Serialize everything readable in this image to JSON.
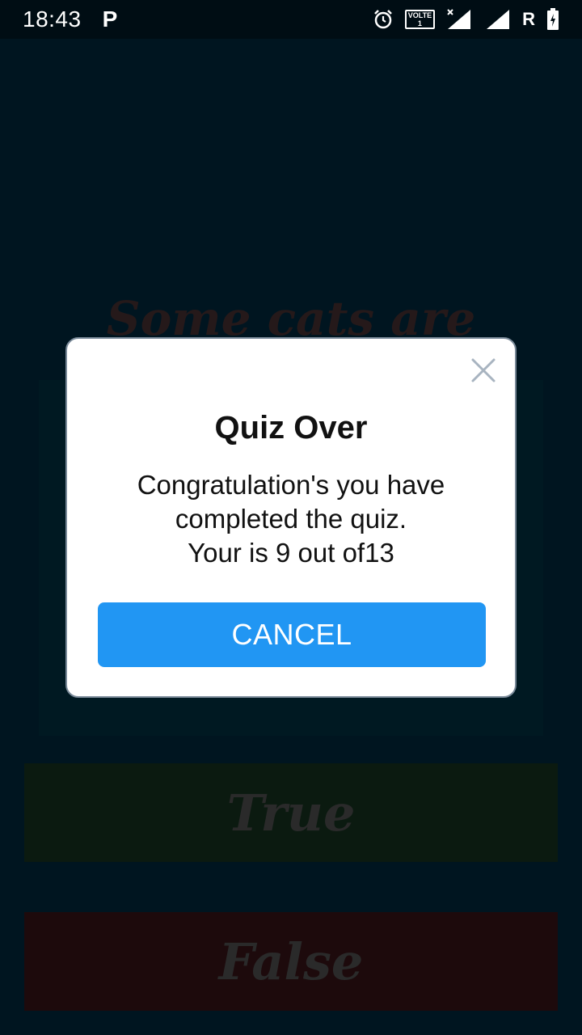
{
  "status_bar": {
    "time": "18:43",
    "app_badge": "P",
    "volte_label": "VOLTE",
    "volte_sub": "1",
    "roaming": "R",
    "icons": [
      "alarm-icon",
      "volte-icon",
      "signal-x-icon",
      "signal-icon",
      "roaming-indicator",
      "battery-charging-icon"
    ]
  },
  "background": {
    "question": "Some cats are actually",
    "true_label": "True",
    "false_label": "False"
  },
  "dialog": {
    "title": "Quiz Over",
    "message_line1": "Congratulation's you have",
    "message_line2": "completed the quiz.",
    "message_line3": "Your is 9 out of13",
    "cancel_label": "CANCEL",
    "close_icon": "close-icon"
  },
  "colors": {
    "accent": "#2196f3",
    "background": "#001520",
    "true_button": "#0b1a10",
    "false_button": "#1d0a0c"
  }
}
